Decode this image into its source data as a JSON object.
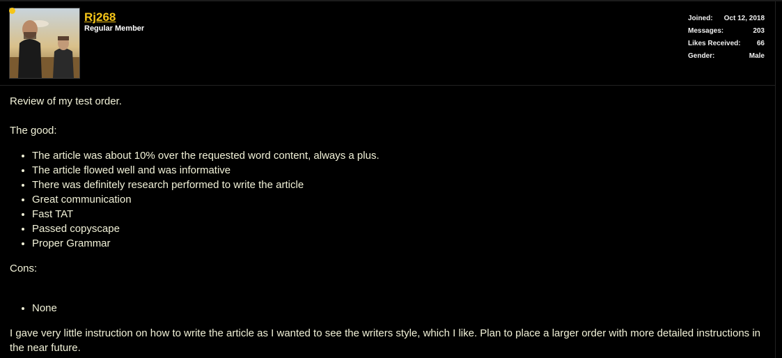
{
  "colors": {
    "background": "#000000",
    "accent": "#f5c518",
    "text": "#f2f2d8"
  },
  "user": {
    "username": "Rj268",
    "title": "Regular Member",
    "online": true
  },
  "stats": [
    {
      "label": "Joined:",
      "value": "Oct 12, 2018"
    },
    {
      "label": "Messages:",
      "value": "203"
    },
    {
      "label": "Likes Received:",
      "value": "66"
    },
    {
      "label": "Gender:",
      "value": "Male"
    }
  ],
  "post": {
    "intro": "Review of my test order.",
    "good_heading": "The good:",
    "good_items": [
      "The article was about 10% over the requested word content, always a plus.",
      "The article flowed well and was informative",
      "There was definitely research performed to write the article",
      "Great communication",
      "Fast TAT",
      "Passed copyscape",
      "Proper Grammar"
    ],
    "cons_heading": "Cons:",
    "cons_items": [
      "None"
    ],
    "closing": "I gave very little instruction on how to write the article as I wanted to see the writers style, which I like. Plan to place a larger order with more detailed instructions in the near future."
  }
}
